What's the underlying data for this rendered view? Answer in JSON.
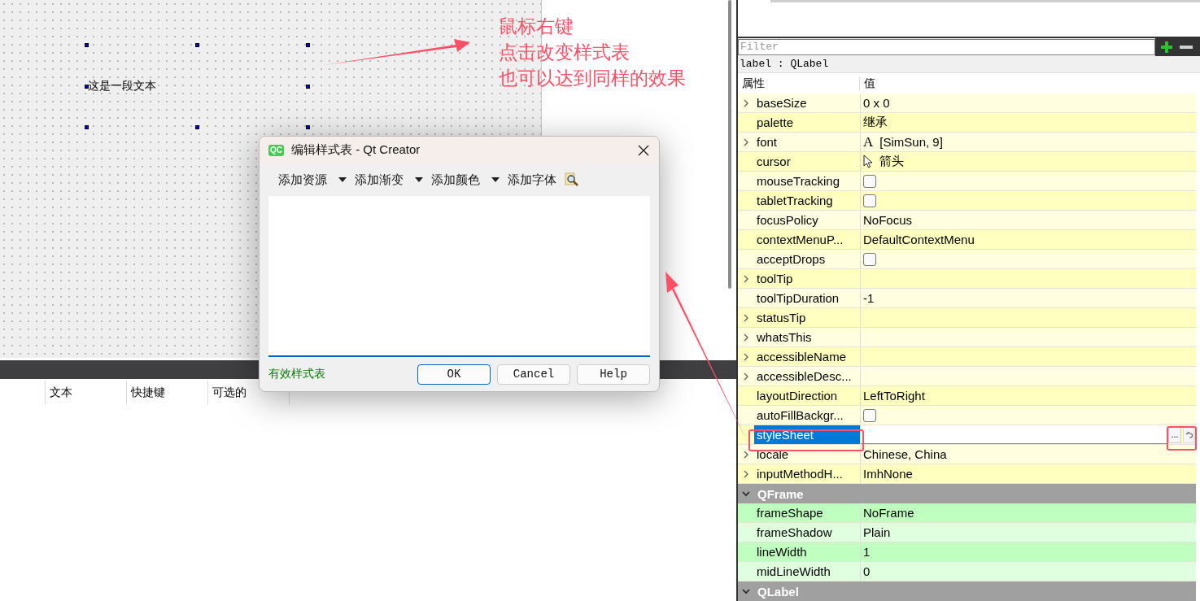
{
  "canvas": {
    "label_text": "这是一段文本"
  },
  "object_table": {
    "columns": [
      "文本",
      "快捷键",
      "可选的"
    ]
  },
  "property_editor": {
    "filter_placeholder": "Filter",
    "object_name": "label : QLabel",
    "headers": [
      "属性",
      "值"
    ],
    "sections": [
      {
        "color": "#ffffbf",
        "properties": [
          {
            "name": "baseSize",
            "kind": "text",
            "value": "0 x 0",
            "expandable": true,
            "selected": false
          },
          {
            "name": "palette",
            "kind": "text",
            "value": "继承",
            "expandable": false,
            "selected": false
          },
          {
            "name": "font",
            "kind": "font",
            "glyph": "A",
            "value": "[SimSun, 9]",
            "expandable": true,
            "selected": false
          },
          {
            "name": "cursor",
            "kind": "cursor",
            "value": "箭头",
            "expandable": false,
            "selected": false
          },
          {
            "name": "mouseTracking",
            "kind": "checkbox",
            "checked": false,
            "expandable": false,
            "selected": false
          },
          {
            "name": "tabletTracking",
            "kind": "checkbox",
            "checked": false,
            "expandable": false,
            "selected": false
          },
          {
            "name": "focusPolicy",
            "kind": "text",
            "value": "NoFocus",
            "expandable": false,
            "selected": false
          },
          {
            "name": "contextMenuP...",
            "kind": "text",
            "value": "DefaultContextMenu",
            "expandable": false,
            "selected": false
          },
          {
            "name": "acceptDrops",
            "kind": "checkbox",
            "checked": false,
            "expandable": false,
            "selected": false
          },
          {
            "name": "toolTip",
            "kind": "text",
            "expandable": true,
            "selected": false
          },
          {
            "name": "toolTipDuration",
            "kind": "text",
            "value": "-1",
            "expandable": false,
            "selected": false
          },
          {
            "name": "statusTip",
            "kind": "text",
            "expandable": true,
            "selected": false
          },
          {
            "name": "whatsThis",
            "kind": "text",
            "expandable": true,
            "selected": false
          },
          {
            "name": "accessibleName",
            "kind": "text",
            "expandable": true,
            "selected": false
          },
          {
            "name": "accessibleDesc...",
            "kind": "text",
            "expandable": true,
            "selected": false
          },
          {
            "name": "layoutDirection",
            "kind": "text",
            "value": "LeftToRight",
            "expandable": false,
            "selected": false
          },
          {
            "name": "autoFillBackgr...",
            "kind": "checkbox",
            "checked": false,
            "expandable": false,
            "selected": false
          },
          {
            "name": "styleSheet",
            "kind": "stylesheet",
            "edit_button": "...",
            "expandable": false,
            "selected": true
          },
          {
            "name": "locale",
            "kind": "text",
            "value": "Chinese, China",
            "expandable": true,
            "selected": false
          },
          {
            "name": "inputMethodH...",
            "kind": "text",
            "value": "ImhNone",
            "expandable": true,
            "selected": false
          }
        ]
      },
      {
        "title": "QFrame",
        "expanded": true,
        "color": "#bfffbf",
        "properties": [
          {
            "name": "frameShape",
            "kind": "text",
            "value": "NoFrame",
            "expandable": false,
            "selected": false
          },
          {
            "name": "frameShadow",
            "kind": "text",
            "value": "Plain",
            "expandable": false,
            "selected": false
          },
          {
            "name": "lineWidth",
            "kind": "text",
            "value": "1",
            "expandable": false,
            "selected": false
          },
          {
            "name": "midLineWidth",
            "kind": "text",
            "value": "0",
            "expandable": false,
            "selected": false
          }
        ]
      },
      {
        "title": "QLabel",
        "expanded": true
      }
    ]
  },
  "dialog": {
    "app_icon_text": "QC",
    "title": "编辑样式表 - Qt Creator",
    "toolbar": [
      {
        "label": "添加资源",
        "dropdown": true
      },
      {
        "label": "添加渐变",
        "dropdown": true
      },
      {
        "label": "添加颜色",
        "dropdown": true
      },
      {
        "label": "添加字体",
        "dropdown": false
      }
    ],
    "status": "有效样式表",
    "valid": true,
    "buttons": [
      {
        "label": "OK",
        "default": true
      },
      {
        "label": "Cancel",
        "default": false
      },
      {
        "label": "Help",
        "default": false
      }
    ]
  },
  "annotation": {
    "lines": [
      "鼠标右键",
      "点击改变样式表",
      "也可以达到同样的效果"
    ]
  }
}
